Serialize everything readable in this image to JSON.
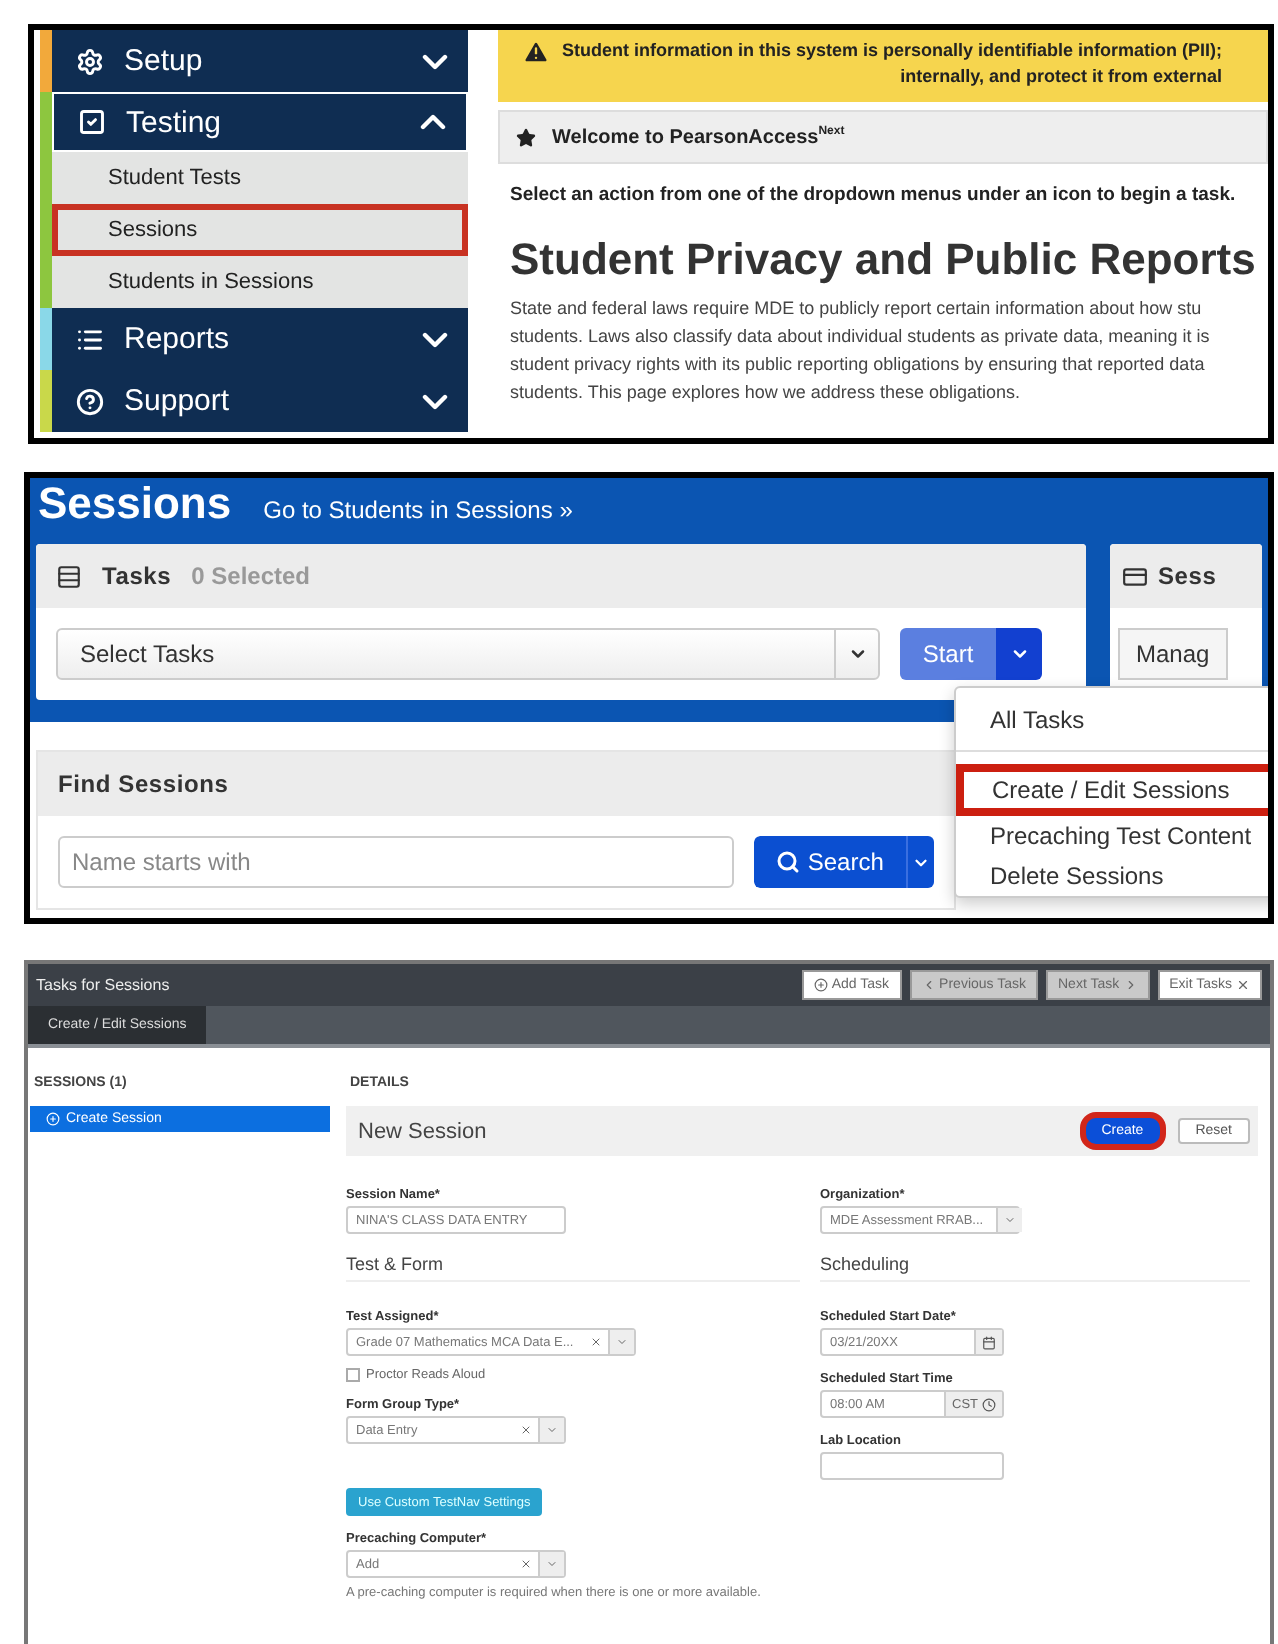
{
  "setup_screen": {
    "sidebar": [
      {
        "label": "Setup",
        "color": "#f2a93b",
        "expanded": false
      },
      {
        "label": "Testing",
        "color": "#8dc63f",
        "expanded": true,
        "children": [
          {
            "label": "Student Tests",
            "highlighted": false
          },
          {
            "label": "Sessions",
            "highlighted": true
          },
          {
            "label": "Students in Sessions",
            "highlighted": false
          }
        ]
      },
      {
        "label": "Reports",
        "color": "#8ad8e8",
        "expanded": false
      },
      {
        "label": "Support",
        "color": "#c9d84a",
        "expanded": false
      }
    ],
    "alert": {
      "lines": [
        "Student information in this system is personally identifiable information (PII);",
        "internally, and protect it from external"
      ]
    },
    "welcome_title": "Welcome to PearsonAccess$^{Next}$",
    "instruction": "Select an action from one of the dropdown menus under an icon to begin a task.",
    "heading": "Student Privacy and Public Reports",
    "paragraph_lines": [
      "State and federal laws require MDE to publicly report certain information about how stu",
      "students. Laws also classify data about individual students as private data, meaning it is",
      "student privacy rights with its public reporting obligations by ensuring that reported data",
      "students. This page explores how we address these obligations."
    ]
  },
  "sessions_screen": {
    "title": "Sessions",
    "link": "Go to Students in Sessions »",
    "tasks": {
      "title": "Tasks",
      "count": "0 Selected",
      "select": "Select Tasks",
      "start_button": "Start"
    },
    "side_card": {
      "title": "Sess",
      "button": "Manag"
    },
    "find": {
      "title": "Find Sessions",
      "placeholder": "Name starts with",
      "search_button": "Search"
    },
    "menu": [
      {
        "label": "All Tasks",
        "highlighted": false,
        "divider_after": true
      },
      {
        "label": "Create / Edit Sessions",
        "highlighted": true,
        "divider_after": false
      },
      {
        "label": "Precaching Test Content",
        "highlighted": false,
        "divider_after": false
      },
      {
        "label": "Delete Sessions",
        "highlighted": false,
        "divider_after": false
      }
    ]
  },
  "tasks_screen": {
    "title": "Tasks for Sessions",
    "toolbar_buttons": [
      {
        "label": "Add Task",
        "kind": "add"
      },
      {
        "label": "Previous Task",
        "kind": "previous"
      },
      {
        "label": "Next Task",
        "kind": "next"
      },
      {
        "label": "Exit Tasks",
        "kind": "exit"
      }
    ],
    "tabs": [
      {
        "label": "Create / Edit Sessions",
        "selected": true
      }
    ],
    "sessions_list": {
      "title": "SESSIONS (1)",
      "items": [
        {
          "label": "Create Session",
          "selected": true
        }
      ]
    },
    "details": {
      "title": "DETAILS",
      "form_title": "New Session",
      "actions": [
        {
          "label": "Create",
          "primary": true,
          "highlighted": true
        },
        {
          "label": "Reset",
          "primary": false,
          "highlighted": false
        }
      ],
      "left": [
        {
          "kind": "text",
          "label": "Session Name*",
          "value": "NINA'S CLASS DATA ENTRY"
        },
        {
          "kind": "section",
          "label": "Test & Form"
        },
        {
          "kind": "select",
          "label": "Test Assigned*",
          "value": "Grade 07 Mathematics MCA Data E..."
        },
        {
          "kind": "checkbox",
          "label": "Proctor Reads Aloud",
          "checked": false
        },
        {
          "kind": "select",
          "label": "Form Group Type*",
          "value": "Data Entry"
        },
        {
          "kind": "button",
          "label": "Use Custom TestNav Settings"
        },
        {
          "kind": "select",
          "label": "Precaching Computer*",
          "value": "Add"
        },
        {
          "kind": "hint",
          "label": "A pre-caching computer is required when there is one or more available."
        }
      ],
      "right": [
        {
          "kind": "select",
          "label": "Organization*",
          "value": "MDE Assessment RRAB..."
        },
        {
          "kind": "section",
          "label": "Scheduling"
        },
        {
          "kind": "date",
          "label": "Scheduled Start Date*",
          "value": "03/21/20XX"
        },
        {
          "kind": "time",
          "label": "Scheduled Start Time",
          "value": "08:00 AM",
          "addon": "CST"
        },
        {
          "kind": "text",
          "label": "Lab Location"
        }
      ]
    }
  }
}
